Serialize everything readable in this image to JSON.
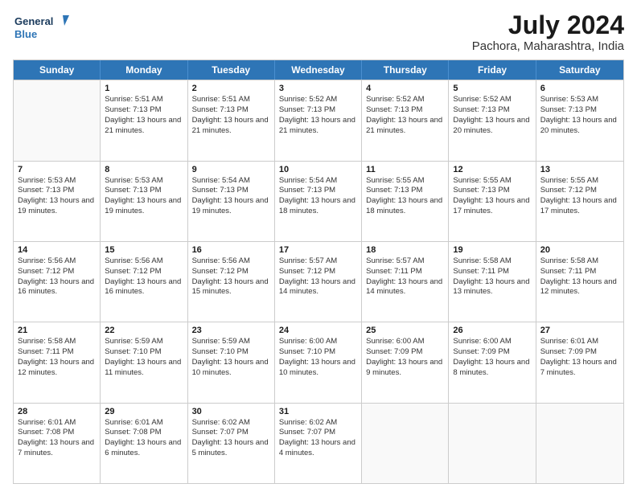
{
  "logo": {
    "text_general": "General",
    "text_blue": "Blue"
  },
  "header": {
    "month": "July 2024",
    "location": "Pachora, Maharashtra, India"
  },
  "days_of_week": [
    "Sunday",
    "Monday",
    "Tuesday",
    "Wednesday",
    "Thursday",
    "Friday",
    "Saturday"
  ],
  "weeks": [
    [
      {
        "day": "",
        "sunrise": "",
        "sunset": "",
        "daylight": ""
      },
      {
        "day": "1",
        "sunrise": "Sunrise: 5:51 AM",
        "sunset": "Sunset: 7:13 PM",
        "daylight": "Daylight: 13 hours and 21 minutes."
      },
      {
        "day": "2",
        "sunrise": "Sunrise: 5:51 AM",
        "sunset": "Sunset: 7:13 PM",
        "daylight": "Daylight: 13 hours and 21 minutes."
      },
      {
        "day": "3",
        "sunrise": "Sunrise: 5:52 AM",
        "sunset": "Sunset: 7:13 PM",
        "daylight": "Daylight: 13 hours and 21 minutes."
      },
      {
        "day": "4",
        "sunrise": "Sunrise: 5:52 AM",
        "sunset": "Sunset: 7:13 PM",
        "daylight": "Daylight: 13 hours and 21 minutes."
      },
      {
        "day": "5",
        "sunrise": "Sunrise: 5:52 AM",
        "sunset": "Sunset: 7:13 PM",
        "daylight": "Daylight: 13 hours and 20 minutes."
      },
      {
        "day": "6",
        "sunrise": "Sunrise: 5:53 AM",
        "sunset": "Sunset: 7:13 PM",
        "daylight": "Daylight: 13 hours and 20 minutes."
      }
    ],
    [
      {
        "day": "7",
        "sunrise": "Sunrise: 5:53 AM",
        "sunset": "Sunset: 7:13 PM",
        "daylight": "Daylight: 13 hours and 19 minutes."
      },
      {
        "day": "8",
        "sunrise": "Sunrise: 5:53 AM",
        "sunset": "Sunset: 7:13 PM",
        "daylight": "Daylight: 13 hours and 19 minutes."
      },
      {
        "day": "9",
        "sunrise": "Sunrise: 5:54 AM",
        "sunset": "Sunset: 7:13 PM",
        "daylight": "Daylight: 13 hours and 19 minutes."
      },
      {
        "day": "10",
        "sunrise": "Sunrise: 5:54 AM",
        "sunset": "Sunset: 7:13 PM",
        "daylight": "Daylight: 13 hours and 18 minutes."
      },
      {
        "day": "11",
        "sunrise": "Sunrise: 5:55 AM",
        "sunset": "Sunset: 7:13 PM",
        "daylight": "Daylight: 13 hours and 18 minutes."
      },
      {
        "day": "12",
        "sunrise": "Sunrise: 5:55 AM",
        "sunset": "Sunset: 7:13 PM",
        "daylight": "Daylight: 13 hours and 17 minutes."
      },
      {
        "day": "13",
        "sunrise": "Sunrise: 5:55 AM",
        "sunset": "Sunset: 7:12 PM",
        "daylight": "Daylight: 13 hours and 17 minutes."
      }
    ],
    [
      {
        "day": "14",
        "sunrise": "Sunrise: 5:56 AM",
        "sunset": "Sunset: 7:12 PM",
        "daylight": "Daylight: 13 hours and 16 minutes."
      },
      {
        "day": "15",
        "sunrise": "Sunrise: 5:56 AM",
        "sunset": "Sunset: 7:12 PM",
        "daylight": "Daylight: 13 hours and 16 minutes."
      },
      {
        "day": "16",
        "sunrise": "Sunrise: 5:56 AM",
        "sunset": "Sunset: 7:12 PM",
        "daylight": "Daylight: 13 hours and 15 minutes."
      },
      {
        "day": "17",
        "sunrise": "Sunrise: 5:57 AM",
        "sunset": "Sunset: 7:12 PM",
        "daylight": "Daylight: 13 hours and 14 minutes."
      },
      {
        "day": "18",
        "sunrise": "Sunrise: 5:57 AM",
        "sunset": "Sunset: 7:11 PM",
        "daylight": "Daylight: 13 hours and 14 minutes."
      },
      {
        "day": "19",
        "sunrise": "Sunrise: 5:58 AM",
        "sunset": "Sunset: 7:11 PM",
        "daylight": "Daylight: 13 hours and 13 minutes."
      },
      {
        "day": "20",
        "sunrise": "Sunrise: 5:58 AM",
        "sunset": "Sunset: 7:11 PM",
        "daylight": "Daylight: 13 hours and 12 minutes."
      }
    ],
    [
      {
        "day": "21",
        "sunrise": "Sunrise: 5:58 AM",
        "sunset": "Sunset: 7:11 PM",
        "daylight": "Daylight: 13 hours and 12 minutes."
      },
      {
        "day": "22",
        "sunrise": "Sunrise: 5:59 AM",
        "sunset": "Sunset: 7:10 PM",
        "daylight": "Daylight: 13 hours and 11 minutes."
      },
      {
        "day": "23",
        "sunrise": "Sunrise: 5:59 AM",
        "sunset": "Sunset: 7:10 PM",
        "daylight": "Daylight: 13 hours and 10 minutes."
      },
      {
        "day": "24",
        "sunrise": "Sunrise: 6:00 AM",
        "sunset": "Sunset: 7:10 PM",
        "daylight": "Daylight: 13 hours and 10 minutes."
      },
      {
        "day": "25",
        "sunrise": "Sunrise: 6:00 AM",
        "sunset": "Sunset: 7:09 PM",
        "daylight": "Daylight: 13 hours and 9 minutes."
      },
      {
        "day": "26",
        "sunrise": "Sunrise: 6:00 AM",
        "sunset": "Sunset: 7:09 PM",
        "daylight": "Daylight: 13 hours and 8 minutes."
      },
      {
        "day": "27",
        "sunrise": "Sunrise: 6:01 AM",
        "sunset": "Sunset: 7:09 PM",
        "daylight": "Daylight: 13 hours and 7 minutes."
      }
    ],
    [
      {
        "day": "28",
        "sunrise": "Sunrise: 6:01 AM",
        "sunset": "Sunset: 7:08 PM",
        "daylight": "Daylight: 13 hours and 7 minutes."
      },
      {
        "day": "29",
        "sunrise": "Sunrise: 6:01 AM",
        "sunset": "Sunset: 7:08 PM",
        "daylight": "Daylight: 13 hours and 6 minutes."
      },
      {
        "day": "30",
        "sunrise": "Sunrise: 6:02 AM",
        "sunset": "Sunset: 7:07 PM",
        "daylight": "Daylight: 13 hours and 5 minutes."
      },
      {
        "day": "31",
        "sunrise": "Sunrise: 6:02 AM",
        "sunset": "Sunset: 7:07 PM",
        "daylight": "Daylight: 13 hours and 4 minutes."
      },
      {
        "day": "",
        "sunrise": "",
        "sunset": "",
        "daylight": ""
      },
      {
        "day": "",
        "sunrise": "",
        "sunset": "",
        "daylight": ""
      },
      {
        "day": "",
        "sunrise": "",
        "sunset": "",
        "daylight": ""
      }
    ]
  ]
}
